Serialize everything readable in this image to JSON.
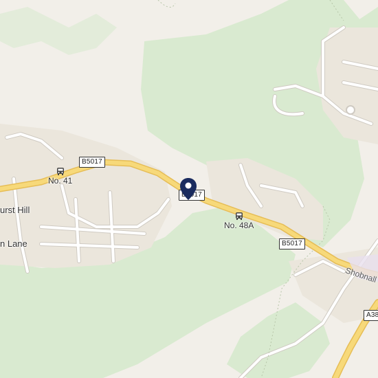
{
  "map": {
    "colors": {
      "land": "#f2efe9",
      "park": "#d9ead0",
      "road_major": "#f7d97a",
      "road_major_casing": "#e6bd56",
      "road_minor": "#ffffff",
      "road_minor_casing": "#cfcac2",
      "pin": "#1a2b5e"
    },
    "road_shields": [
      {
        "name": "b5017-west",
        "text": "B5017"
      },
      {
        "name": "b5017-center",
        "text": "B5017"
      },
      {
        "name": "b5017-east",
        "text": "B5017"
      },
      {
        "name": "a38",
        "text": "A38"
      }
    ],
    "bus_stops": [
      {
        "name": "no-41",
        "label": "No. 41"
      },
      {
        "name": "no-48a",
        "label": "No. 48A"
      }
    ],
    "places": [
      {
        "name": "hurst-hill",
        "text": "urst Hill"
      },
      {
        "name": "lane",
        "text": "n Lane"
      }
    ],
    "streets": [
      {
        "name": "shobnall",
        "text": "Shobnall"
      }
    ],
    "marker": {
      "icon": "location-pin-icon"
    }
  }
}
